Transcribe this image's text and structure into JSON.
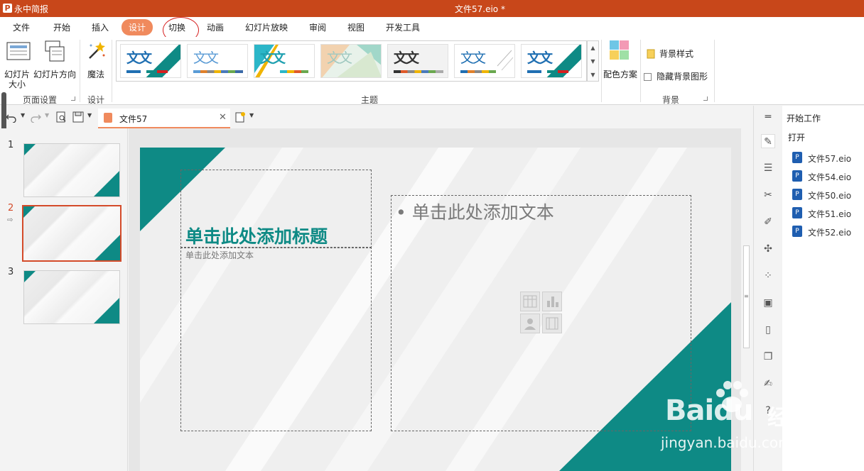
{
  "app": {
    "name": "永中简报",
    "logo": "P",
    "doc_title": "文件57.eio *"
  },
  "menu": {
    "items": [
      "文件",
      "开始",
      "插入",
      "设计",
      "切换",
      "动画",
      "幻灯片放映",
      "审阅",
      "视图",
      "开发工具"
    ],
    "active": "设计"
  },
  "ribbon": {
    "slide_size": "幻灯片大小",
    "slide_orientation": "幻灯片方向",
    "magic": "魔法",
    "page_setup_group": "页面设置",
    "design_group": "设计",
    "theme_group": "主题",
    "theme_text": "文文",
    "color_scheme": "配色方案",
    "bg_style": "背景样式",
    "hide_bg": "隐藏背景图形",
    "background_group": "背景"
  },
  "tabs": {
    "doc_tab": "文件57"
  },
  "thumbnails": {
    "numbers": [
      "1",
      "2",
      "3"
    ],
    "selected": "2"
  },
  "slide": {
    "title_placeholder": "单击此处添加标题",
    "subtitle_placeholder": "单击此处添加文本",
    "content_placeholder": "• 单击此处添加文本"
  },
  "right_pane": {
    "header": "开始工作",
    "open_label": "打开",
    "recent_files": [
      "文件57.eio",
      "文件54.eio",
      "文件50.eio",
      "文件51.eio",
      "文件52.eio"
    ]
  },
  "watermark": {
    "logo": "Baidu",
    "cn": "经验",
    "url": "jingyan.baidu.com"
  },
  "colors": {
    "title_bar": "#c8471a",
    "accent": "#f08a5d",
    "teal": "#0e8a85",
    "annotation": "#d62020"
  }
}
